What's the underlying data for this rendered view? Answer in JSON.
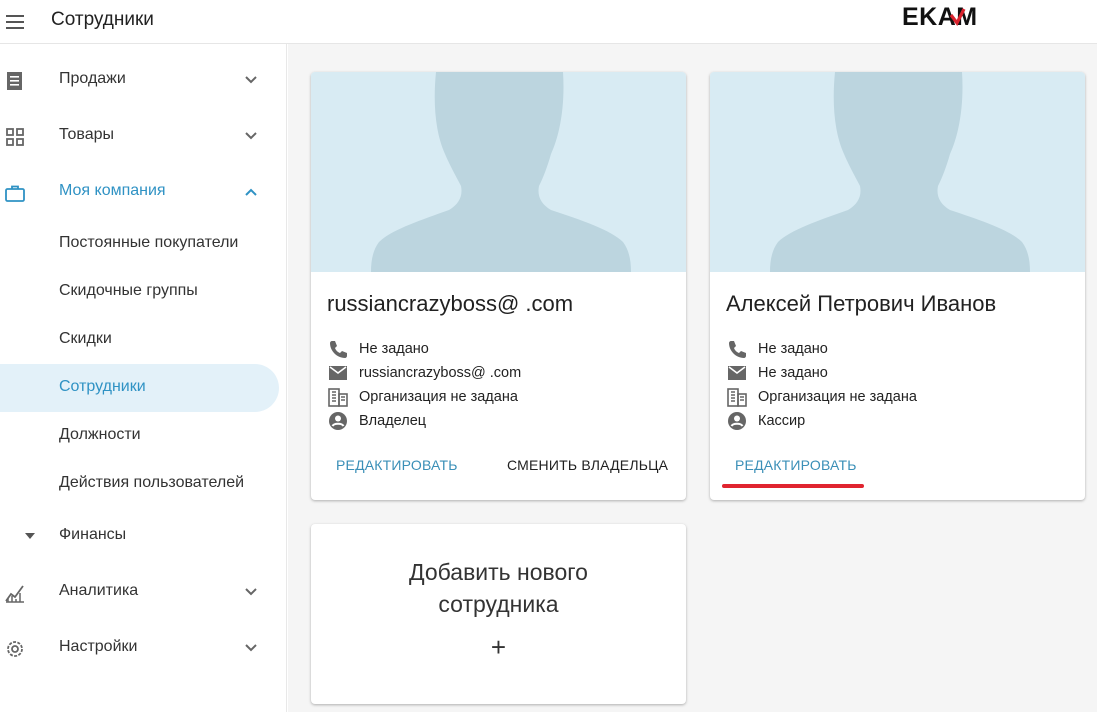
{
  "header": {
    "title": "Сотрудники",
    "logo_text": "EKAM"
  },
  "sidebar": {
    "items": [
      {
        "label": "Продажи",
        "icon": "receipt-icon",
        "expanded": false
      },
      {
        "label": "Товары",
        "icon": "grid-icon",
        "expanded": false
      },
      {
        "label": "Моя компания",
        "icon": "briefcase-icon",
        "expanded": true
      },
      {
        "label": "Финансы",
        "icon": "caret-down-icon",
        "expanded": false
      },
      {
        "label": "Аналитика",
        "icon": "chart-icon",
        "expanded": false
      },
      {
        "label": "Настройки",
        "icon": "gear-icon",
        "expanded": false
      }
    ],
    "company_subitems": [
      "Постоянные покупатели",
      "Скидочные группы",
      "Скидки",
      "Сотрудники",
      "Должности",
      "Действия пользователей"
    ],
    "selected_subitem": "Сотрудники"
  },
  "employees": [
    {
      "name": "russiancrazyboss@          .com",
      "phone": "Не задано",
      "email": "russiancrazyboss@          .com",
      "organization": "Организация не задана",
      "role": "Владелец",
      "actions": [
        "РЕДАКТИРОВАТЬ",
        "СМЕНИТЬ ВЛАДЕЛЬЦА"
      ]
    },
    {
      "name": "Алексей Петрович Иванов",
      "phone": "Не задано",
      "email": "Не задано",
      "organization": "Организация не задана",
      "role": "Кассир",
      "actions": [
        "РЕДАКТИРОВАТЬ"
      ]
    }
  ],
  "add_card": {
    "title_line1": "Добавить нового",
    "title_line2": "сотрудника",
    "plus": "+"
  },
  "colors": {
    "accent": "#2f92c4",
    "selected_bg": "#e3f1f9",
    "avatar_bg": "#d8ebf3",
    "avatar_silhouette": "#bcd5df",
    "highlight_underline": "#e0242f",
    "logo_red": "#d9232e"
  }
}
